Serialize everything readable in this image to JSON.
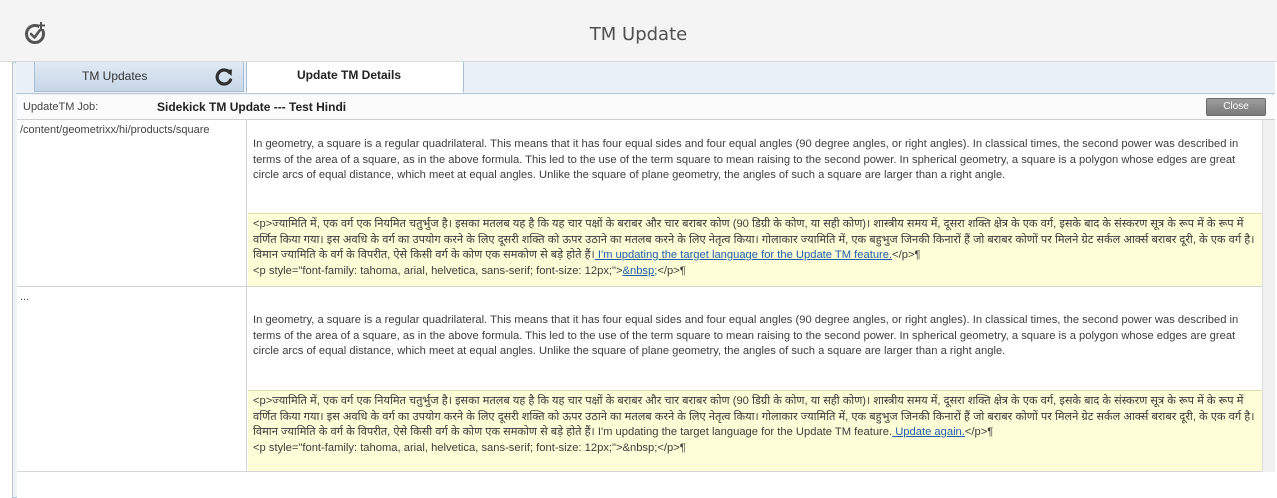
{
  "window": {
    "title": "TM Update"
  },
  "tabs": {
    "updates_label": "TM Updates",
    "details_label": "Update TM Details"
  },
  "job": {
    "label": "UpdateTM Job:",
    "name": "Sidekick TM Update --- Test Hindi",
    "close_label": "Close"
  },
  "rows": [
    {
      "path": "/content/geometrixx/hi/products/square",
      "source": "In geometry, a square is a regular quadrilateral. This means that it has four equal sides and four equal angles (90 degree angles, or right angles). In classical times, the second power was described in terms of the area of a square, as in the above formula. This led to the use of the term square to mean raising to the second power. In spherical geometry, a square is a polygon whose edges are great circle arcs of equal distance, which meet at equal angles. Unlike the square of plane geometry, the angles of such a square are larger than a right angle.",
      "target_text": "<p>ज्यामिति में, एक वर्ग एक नियमित चतुर्भुज है। इसका मतलब यह है कि यह चार पक्षों के बराबर और चार बराबर कोण (90 डिग्री के कोण, या सही कोण)। शास्त्रीय समय में, दूसरा शक्ति क्षेत्र के एक वर्ग, इसके बाद के संस्करण सूत्र के रूप में के रूप में वर्णित किया गया। इस अवधि के वर्ग का उपयोग करने के लिए दूसरी शक्ति को ऊपर उठाने का मतलब करने के लिए नेतृत्व किया। गोलाकार ज्यामिति में, एक बहुभुज जिनकी किनारों हैं जो बराबर कोणों पर मिलने ग्रेट सर्कल आर्क्स बराबर दूरी, के एक वर्ग है। विमान ज्यामिति के वर्ग के विपरीत, ऐसे किसी वर्ग के कोण एक समकोण से बड़े होते हैं।",
      "target_link": " I'm updating the target language for the Update TM feature.",
      "target_close": "</p>¶",
      "style_prefix": "<p style=\"font-family: tahoma, arial, helvetica, sans-serif; font-size: 12px;\">",
      "style_link": "&nbsp;",
      "style_suffix": "</p>¶"
    },
    {
      "path": "...",
      "source": "In geometry, a square is a regular quadrilateral. This means that it has four equal sides and four equal angles (90 degree angles, or right angles). In classical times, the second power was described in terms of the area of a square, as in the above formula. This led to the use of the term square to mean raising to the second power. In spherical geometry, a square is a polygon whose edges are great circle arcs of equal distance, which meet at equal angles. Unlike the square of plane geometry, the angles of such a square are larger than a right angle.",
      "target_text": "<p>ज्यामिति में, एक वर्ग एक नियमित चतुर्भुज है। इसका मतलब यह है कि यह चार पक्षों के बराबर और चार बराबर कोण (90 डिग्री के कोण, या सही कोण)। शास्त्रीय समय में, दूसरा शक्ति क्षेत्र के एक वर्ग, इसके बाद के संस्करण सूत्र के रूप में के रूप में वर्णित किया गया। इस अवधि के वर्ग का उपयोग करने के लिए दूसरी शक्ति को ऊपर उठाने का मतलब करने के लिए नेतृत्व किया। गोलाकार ज्यामिति में, एक बहुभुज जिनकी किनारों हैं जो बराबर कोणों पर मिलने ग्रेट सर्कल आर्क्स बराबर दूरी, के एक वर्ग है। विमान ज्यामिति के वर्ग के विपरीत, ऐसे किसी वर्ग के कोण एक समकोण से बड़े होते हैं। I'm updating the target language for the Update TM feature.",
      "target_link": " Update again.",
      "target_close": "</p>¶",
      "style_text": "<p style=\"font-family: tahoma, arial, helvetica, sans-serif; font-size: 12px;\">&nbsp;</p>¶"
    }
  ],
  "colors": {
    "target_highlight": "#fdfdd7",
    "link": "#1f5fa6",
    "tab_active": "#ffffff"
  },
  "icons": [
    "app-logo-icon",
    "refresh-icon"
  ]
}
